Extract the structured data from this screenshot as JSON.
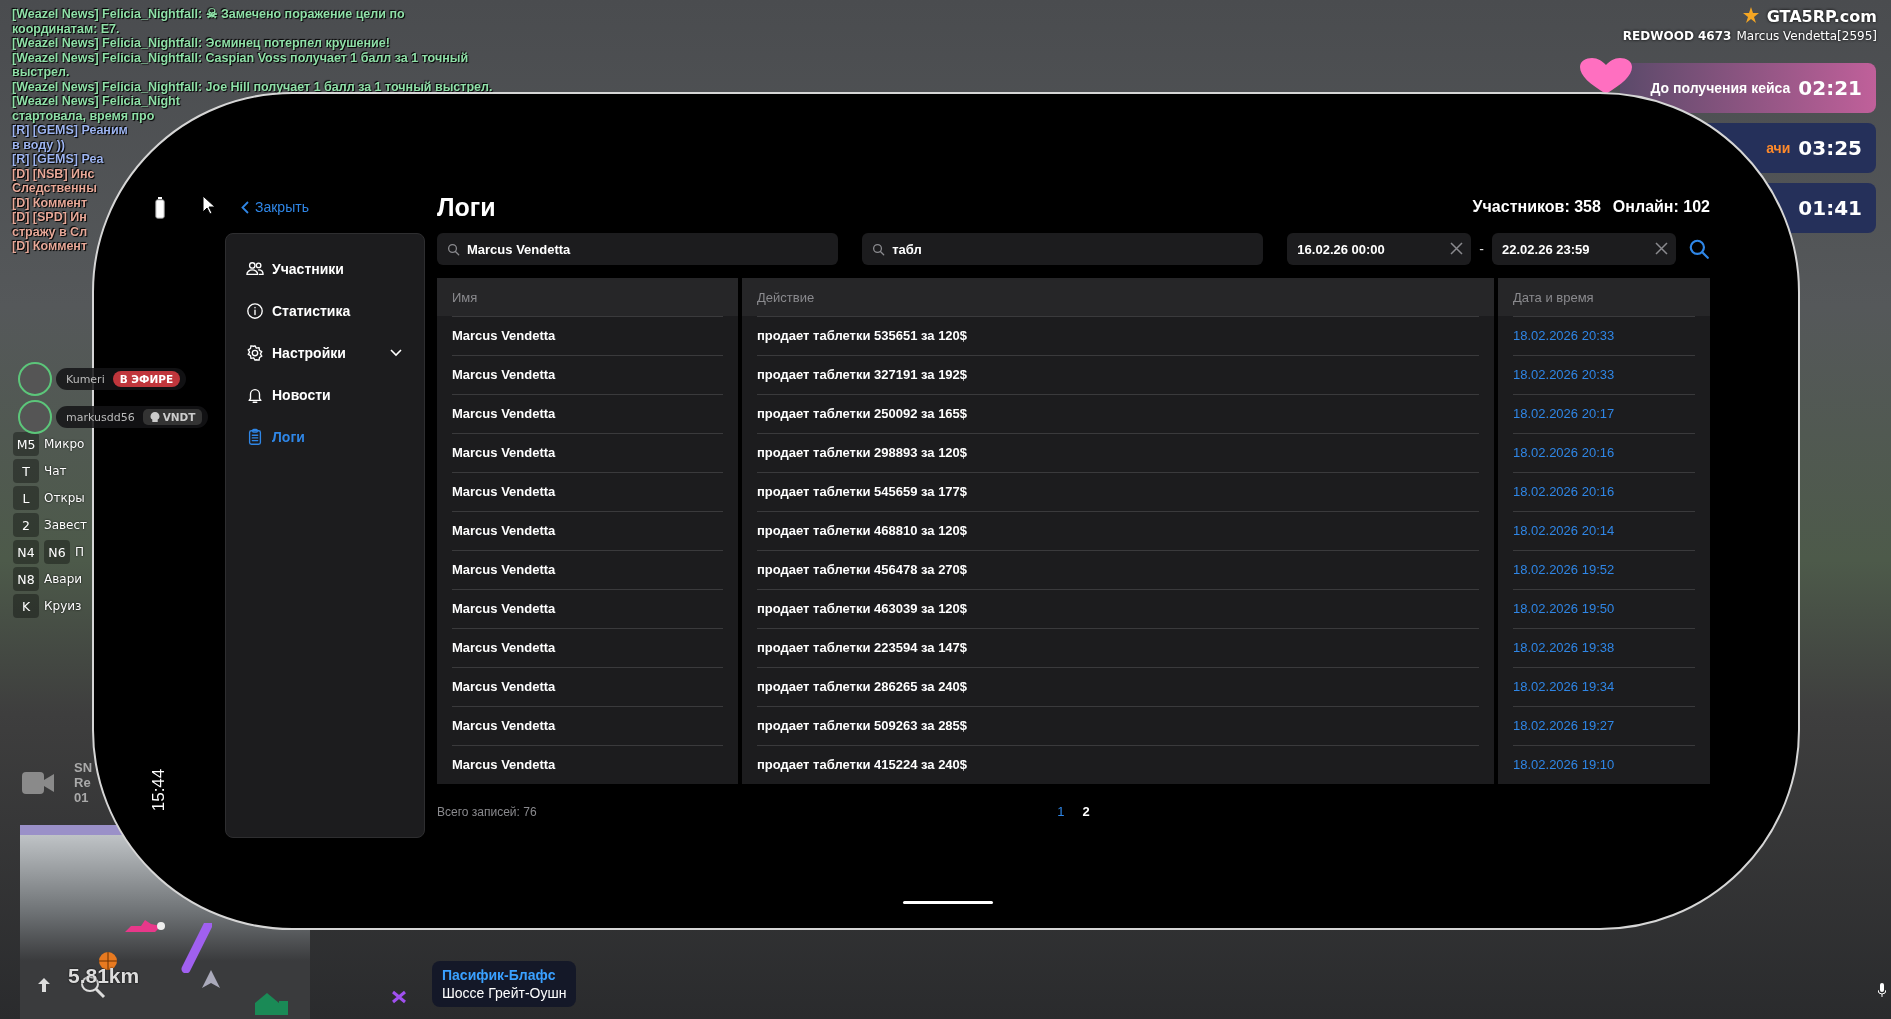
{
  "chat": [
    {
      "color": "#8fe0a8",
      "lines": [
        "[Weazel News] Felicia_Nightfall: ☠ Замечено поражение цели по",
        "координатам: E7."
      ]
    },
    {
      "color": "#8fe0a8",
      "lines": [
        "[Weazel News] Felicia_Nightfall: Эсминец потерпел крушение!"
      ]
    },
    {
      "color": "#8fe0a8",
      "lines": [
        "[Weazel News] Felicia_Nightfall: Caspian Voss получает 1 балл за 1 точный",
        "выстрел."
      ]
    },
    {
      "color": "#8fe0a8",
      "lines": [
        "[Weazel News] Felicia_Nightfall: Joe Hill получает 1 балл за 1 точный выстрел."
      ]
    },
    {
      "color": "#8fe0a8",
      "lines": [
        "[Weazel News] Felicia_Night",
        "стартовала, время про"
      ]
    },
    {
      "color": "#9db4f0",
      "lines": [
        "[R] [GEMS] Реаним",
        "в воду ))"
      ]
    },
    {
      "color": "#9db4f0",
      "lines": [
        "[R] [GEMS] Реа"
      ]
    },
    {
      "color": "#e8a898",
      "lines": [
        "[D] [NSB] Инс",
        "Следственны"
      ]
    },
    {
      "color": "#e8a898",
      "lines": [
        "[D] Коммент"
      ]
    },
    {
      "color": "#e8a898",
      "lines": [
        "[D] [SPD] Ин",
        "стражу в Сл"
      ]
    },
    {
      "color": "#e8a898",
      "lines": [
        "[D] Коммент"
      ]
    }
  ],
  "hud": {
    "logo": "GTA5RP.com",
    "server": "REDWOOD 4673",
    "player": "Marcus Vendetta[2595]",
    "timers": [
      {
        "kind": "case",
        "label": "До получения кейса",
        "time": "02:21"
      },
      {
        "kind": "task",
        "label": "ачи",
        "time": "03:25"
      },
      {
        "kind": "task",
        "time": "01:41"
      }
    ],
    "streams": [
      {
        "kind": "live",
        "name": "Kumeri",
        "badge": "В ЭФИРЕ"
      },
      {
        "kind": "crew",
        "name": "markusdd56",
        "badge": "VNDT"
      }
    ],
    "keybinds": [
      {
        "keys": [
          "M5"
        ],
        "label": "Микро"
      },
      {
        "keys": [
          "T"
        ],
        "label": "Чат"
      },
      {
        "keys": [
          "L"
        ],
        "label": "Откры"
      },
      {
        "keys": [
          "2"
        ],
        "label": "Завест"
      },
      {
        "keys": [
          "N4",
          "N6"
        ],
        "label": "П"
      },
      {
        "keys": [
          "N8"
        ],
        "label": "Авари"
      },
      {
        "keys": [
          "K"
        ],
        "label": "Круиз"
      }
    ],
    "camera": [
      "SN",
      "Re",
      "01"
    ],
    "distance": "5.81km",
    "location": {
      "area": "Пасифик-Блафс",
      "street": "Шоссе Грейт-Оушн"
    }
  },
  "phone": {
    "clock": "15:44",
    "back": "Закрыть",
    "title": "Логи",
    "stats": [
      "Участников: 358",
      "Онлайн: 102"
    ],
    "menu": [
      {
        "label": "Участники",
        "selected": false
      },
      {
        "label": "Статистика",
        "selected": false
      },
      {
        "label": "Настройки",
        "selected": false,
        "expanded": false
      },
      {
        "label": "Новости",
        "selected": false
      },
      {
        "label": "Логи",
        "selected": true
      }
    ],
    "filters": {
      "name": "Marcus Vendetta",
      "action": "табл",
      "from": "16.02.26 00:00",
      "to": "22.02.26 23:59",
      "separator": "-"
    },
    "table": {
      "columns": [
        "Имя",
        "Действие",
        "Дата и время"
      ],
      "rows": [
        [
          "Marcus Vendetta",
          "продает таблетки 535651 за 120$",
          "18.02.2026 20:33"
        ],
        [
          "Marcus Vendetta",
          "продает таблетки 327191 за 192$",
          "18.02.2026 20:33"
        ],
        [
          "Marcus Vendetta",
          "продает таблетки 250092 за 165$",
          "18.02.2026 20:17"
        ],
        [
          "Marcus Vendetta",
          "продает таблетки 298893 за 120$",
          "18.02.2026 20:16"
        ],
        [
          "Marcus Vendetta",
          "продает таблетки 545659 за 177$",
          "18.02.2026 20:16"
        ],
        [
          "Marcus Vendetta",
          "продает таблетки 468810 за 120$",
          "18.02.2026 20:14"
        ],
        [
          "Marcus Vendetta",
          "продает таблетки 456478 за 270$",
          "18.02.2026 19:52"
        ],
        [
          "Marcus Vendetta",
          "продает таблетки 463039 за 120$",
          "18.02.2026 19:50"
        ],
        [
          "Marcus Vendetta",
          "продает таблетки 223594 за 147$",
          "18.02.2026 19:38"
        ],
        [
          "Marcus Vendetta",
          "продает таблетки 286265 за 240$",
          "18.02.2026 19:34"
        ],
        [
          "Marcus Vendetta",
          "продает таблетки 509263 за 285$",
          "18.02.2026 19:27"
        ],
        [
          "Marcus Vendetta",
          "продает таблетки 415224 за 240$",
          "18.02.2026 19:10"
        ]
      ]
    },
    "total": "Всего записей: 76",
    "pages": [
      {
        "label": "1",
        "selected": true
      },
      {
        "label": "2",
        "selected": false
      }
    ]
  }
}
